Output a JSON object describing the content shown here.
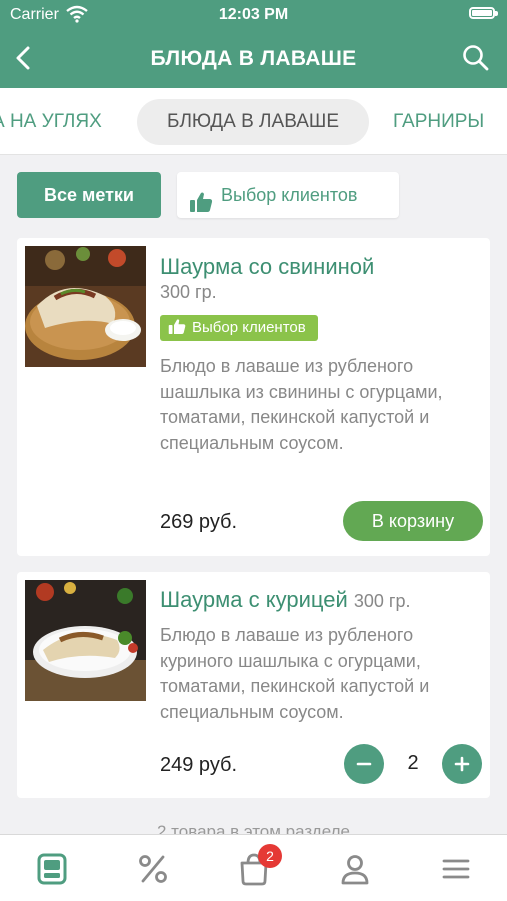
{
  "status_bar": {
    "carrier": "Carrier",
    "time": "12:03 PM",
    "battery_level": 1.0
  },
  "header": {
    "title": "БЛЮДА В ЛАВАШЕ"
  },
  "category_tabs": [
    {
      "label": "А НА УГЛЯХ",
      "selected": false
    },
    {
      "label": "БЛЮДА В ЛАВАШЕ",
      "selected": true
    },
    {
      "label": "ГАРНИРЫ",
      "selected": false
    }
  ],
  "filters": {
    "all_label": "Все метки",
    "customer_choice_label": "Выбор клиентов"
  },
  "products": [
    {
      "name": "Шаурма со свининой",
      "weight": "300 гр.",
      "badge": "Выбор клиентов",
      "description": "Блюдо в лаваше из рубленого шашлыка из свинины с огурцами, томатами, пекинской капустой и специальным соусом.",
      "price": "269 руб.",
      "button": "В корзину"
    },
    {
      "name": "Шаурма с курицей",
      "weight": "300 гр.",
      "description": "Блюдо в лаваше из рубленого куриного шашлыка с огурцами, томатами, пекинской капустой и специальным соусом.",
      "price": "249 руб.",
      "quantity": "2"
    }
  ],
  "footer_note": "2 товара в этом разделе",
  "tab_bar": {
    "cart_count": "2"
  },
  "colors": {
    "primary": "#4f9d80",
    "add_button": "#62a853",
    "badge": "#8bc34a",
    "cart_badge": "#e53935"
  },
  "icons": [
    "back-arrow-icon",
    "search-icon",
    "thumbs-up-icon",
    "minus-icon",
    "plus-icon",
    "menu-catalog-icon",
    "percent-icon",
    "cart-icon",
    "profile-icon",
    "hamburger-icon"
  ]
}
